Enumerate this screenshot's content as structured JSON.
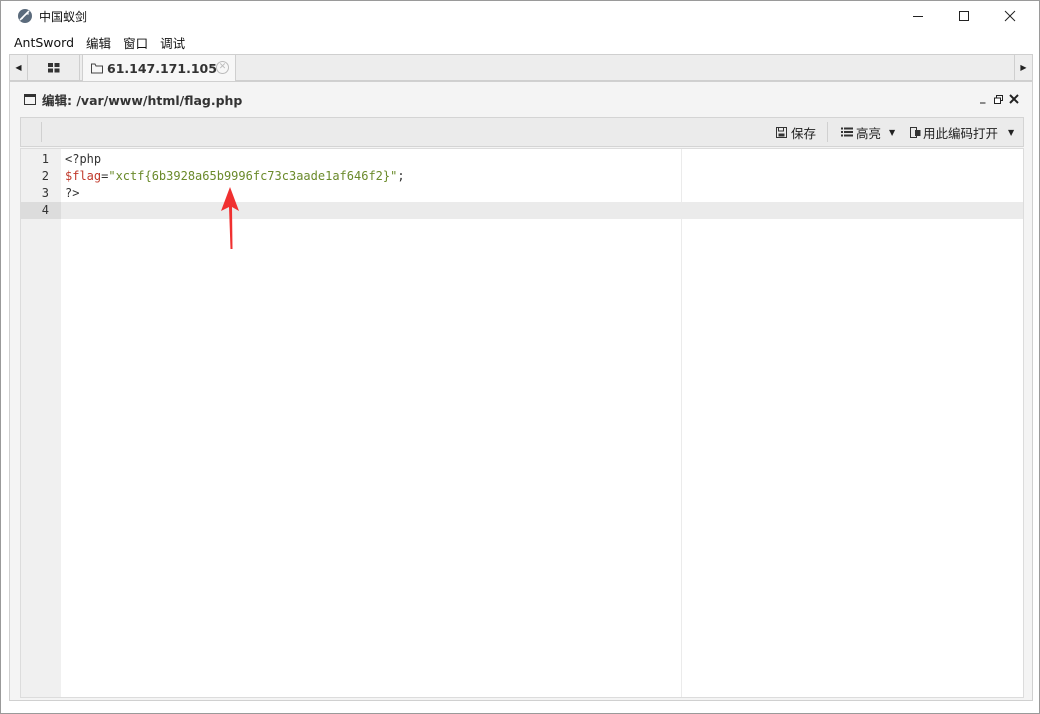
{
  "window": {
    "title": "中国蚁剑"
  },
  "menu": [
    "AntSword",
    "编辑",
    "窗口",
    "调试"
  ],
  "tabs": {
    "active_label": "61.147.171.105"
  },
  "editor": {
    "title": "编辑: /var/www/html/flag.php",
    "toolbar": {
      "save": "保存",
      "highlight": "高亮",
      "open_with_encoding": "用此编码打开"
    },
    "lines": [
      {
        "num": "1",
        "tag": "<?php",
        "var": "",
        "op": "",
        "str": "",
        "end": ""
      },
      {
        "num": "2",
        "tag": "",
        "var": "$flag",
        "op": "=",
        "str": "\"xctf{6b3928a65b9996fc73c3aade1af646f2}\"",
        "end": ";"
      },
      {
        "num": "3",
        "tag": "?>",
        "var": "",
        "op": "",
        "str": "",
        "end": ""
      },
      {
        "num": "4",
        "tag": "",
        "var": "",
        "op": "",
        "str": "",
        "end": ""
      }
    ]
  },
  "colors": {
    "arrow": "#f03030",
    "string": "#6a8a2a",
    "variable": "#c0392b"
  }
}
